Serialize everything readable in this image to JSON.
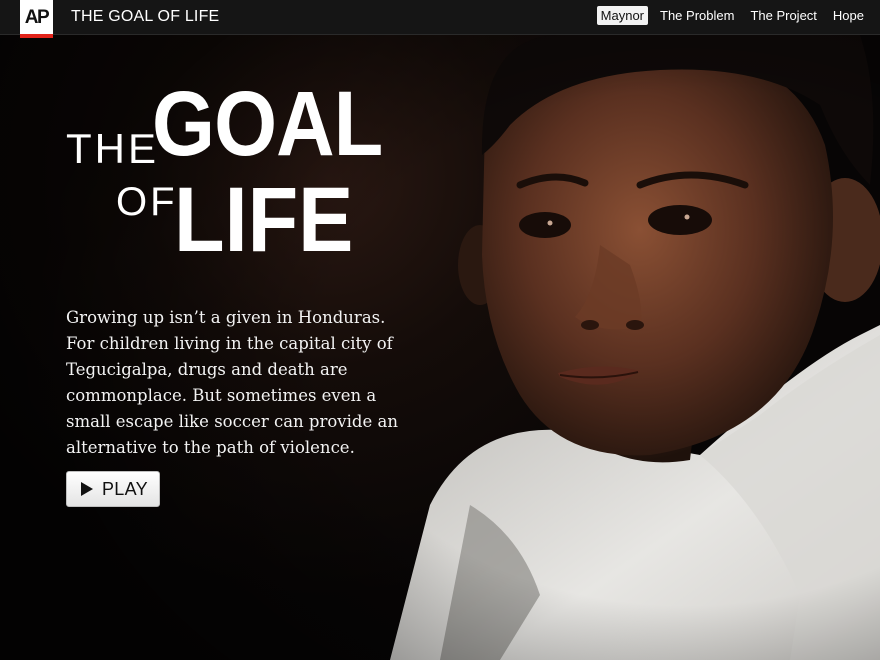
{
  "brand": {
    "logo_text": "AP",
    "site_title": "THE GOAL OF LIFE"
  },
  "nav": {
    "items": [
      {
        "label": "Maynor",
        "active": true
      },
      {
        "label": "The Problem",
        "active": false
      },
      {
        "label": "The Project",
        "active": false
      },
      {
        "label": "Hope",
        "active": false
      }
    ]
  },
  "hero": {
    "headline_the": "THE",
    "headline_goal": "GOAL",
    "headline_of": "OF",
    "headline_life": "LIFE",
    "intro": "Growing up isn’t a given in Honduras. For children living in the capital city of Tegucigalpa, drugs and death are commonplace. But sometimes even a small escape like soccer can provide an alternative to the path of violence.",
    "play_label": "PLAY",
    "play_icon": "play-triangle-icon"
  },
  "colors": {
    "nav_background": "#151515",
    "logo_accent": "#e2231a",
    "text": "#ffffff",
    "button_background": "#f2f2f2"
  }
}
